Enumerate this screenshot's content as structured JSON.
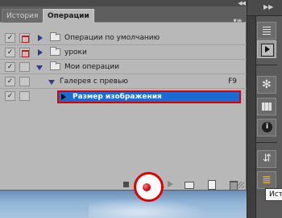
{
  "tabs": [
    {
      "label": "История",
      "active": false
    },
    {
      "label": "Операции",
      "active": true
    }
  ],
  "actions_list": [
    {
      "label": "Операции по умолчанию",
      "type": "set",
      "expanded": false,
      "checked": true,
      "dialog": true
    },
    {
      "label": "уроки",
      "type": "set",
      "expanded": false,
      "checked": true,
      "dialog": true
    },
    {
      "label": "Мои операции",
      "type": "set",
      "expanded": true,
      "checked": true,
      "dialog": false
    },
    {
      "label": "Галерея с превью",
      "type": "action",
      "expanded": true,
      "checked": true,
      "dialog": false,
      "shortcut": "F9"
    },
    {
      "label": "Размер изображения",
      "type": "step",
      "selected": true,
      "checked": true,
      "dialog": false
    }
  ],
  "toolbar": {
    "buttons": [
      "stop-icon",
      "record-icon",
      "play-icon",
      "new-set-icon",
      "new-action-icon",
      "trash-icon"
    ],
    "highlighted": "record"
  },
  "dock": {
    "icons": [
      "history-lines-icon",
      "actions-play-icon",
      "navigator-wheel-icon",
      "histogram-icon",
      "info-icon",
      "plug-icon",
      "history-icon"
    ]
  },
  "tooltip": {
    "text": "Исто"
  },
  "colors": {
    "panel_bg": "#b8b8b8",
    "selection": "#1a6bd3",
    "highlight_outline": "#e00000",
    "dock_bg": "#5a5a5a"
  }
}
